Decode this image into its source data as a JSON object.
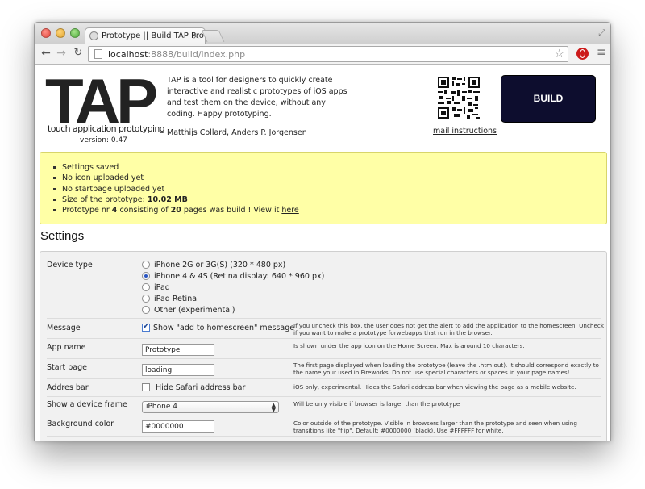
{
  "browser": {
    "tab_title": "Prototype || Build TAP Protot",
    "tab_close": "×",
    "url_host": "localhost",
    "url_path": ":8888/build/index.php"
  },
  "header": {
    "logo": "TAP",
    "logo_subtitle": "touch application prototyping",
    "version": "version: 0.47",
    "intro": "TAP is a tool for designers to quickly create interactive and realistic prototypes of iOS apps and test them on the device, without any coding. Happy prototyping.",
    "authors": "Matthijs Collard, Anders P. Jorgensen",
    "mail_link": "mail instructions",
    "build_label": "BUILD"
  },
  "notice": {
    "items": [
      "Settings saved",
      "No icon uploaded yet",
      "No startpage uploaded yet"
    ],
    "size_prefix": "Size of the prototype: ",
    "size_value": "10.02 MB",
    "proto_prefix": "Prototype nr ",
    "proto_nr": "4",
    "proto_mid": " consisting of ",
    "proto_pages": "20",
    "proto_suffix": " pages was build ! View it ",
    "here_link": "here"
  },
  "settings": {
    "title": "Settings",
    "device_type": {
      "label": "Device type",
      "options": [
        {
          "label": "iPhone 2G or 3G(S) (320 * 480 px)",
          "checked": false
        },
        {
          "label": "iPhone 4 & 4S (Retina display: 640 * 960 px)",
          "checked": true
        },
        {
          "label": "iPad",
          "checked": false
        },
        {
          "label": "iPad Retina",
          "checked": false
        },
        {
          "label": "Other (experimental)",
          "checked": false
        }
      ]
    },
    "message": {
      "label": "Message",
      "checkbox_label": "Show \"add to homescreen\" message",
      "checked": true,
      "help": "If you uncheck this box, the user does not get the alert to add the application to the homescreen. Uncheck if you want to make a prototype forwebapps that run in the browser."
    },
    "app_name": {
      "label": "App name",
      "value": "Prototype",
      "help": "Is shown under the app icon on the Home Screen. Max is around 10 characters."
    },
    "start_page": {
      "label": "Start page",
      "value": "loading",
      "help": "The first page displayed when loading the prototype (leave the .htm out). It should correspond exactly to the name your used in Fireworks. Do not use special characters or spaces in your page names!"
    },
    "address_bar": {
      "label": "Addres bar",
      "checkbox_label": "Hide Safari address bar",
      "checked": false,
      "help": "iOS only, experimental. Hides the Safari address bar when viewing the page as a mobile website."
    },
    "device_frame": {
      "label": "Show a device frame",
      "selected": "iPhone 4",
      "help": "Will be only visible if browser is larger than the prototype"
    },
    "background_color": {
      "label": "Background color",
      "value": "#0000000",
      "help": "Color outside of the prototype. Visible in browsers larger than the prototype and seen when using transitions like \"flip\". Default: #0000000 (black). Use #FFFFFF for white."
    }
  },
  "colors": {
    "notice_bg": "#ffffa6",
    "build_bg": "#0d0d2e",
    "radio_accent": "#2b56c2"
  }
}
